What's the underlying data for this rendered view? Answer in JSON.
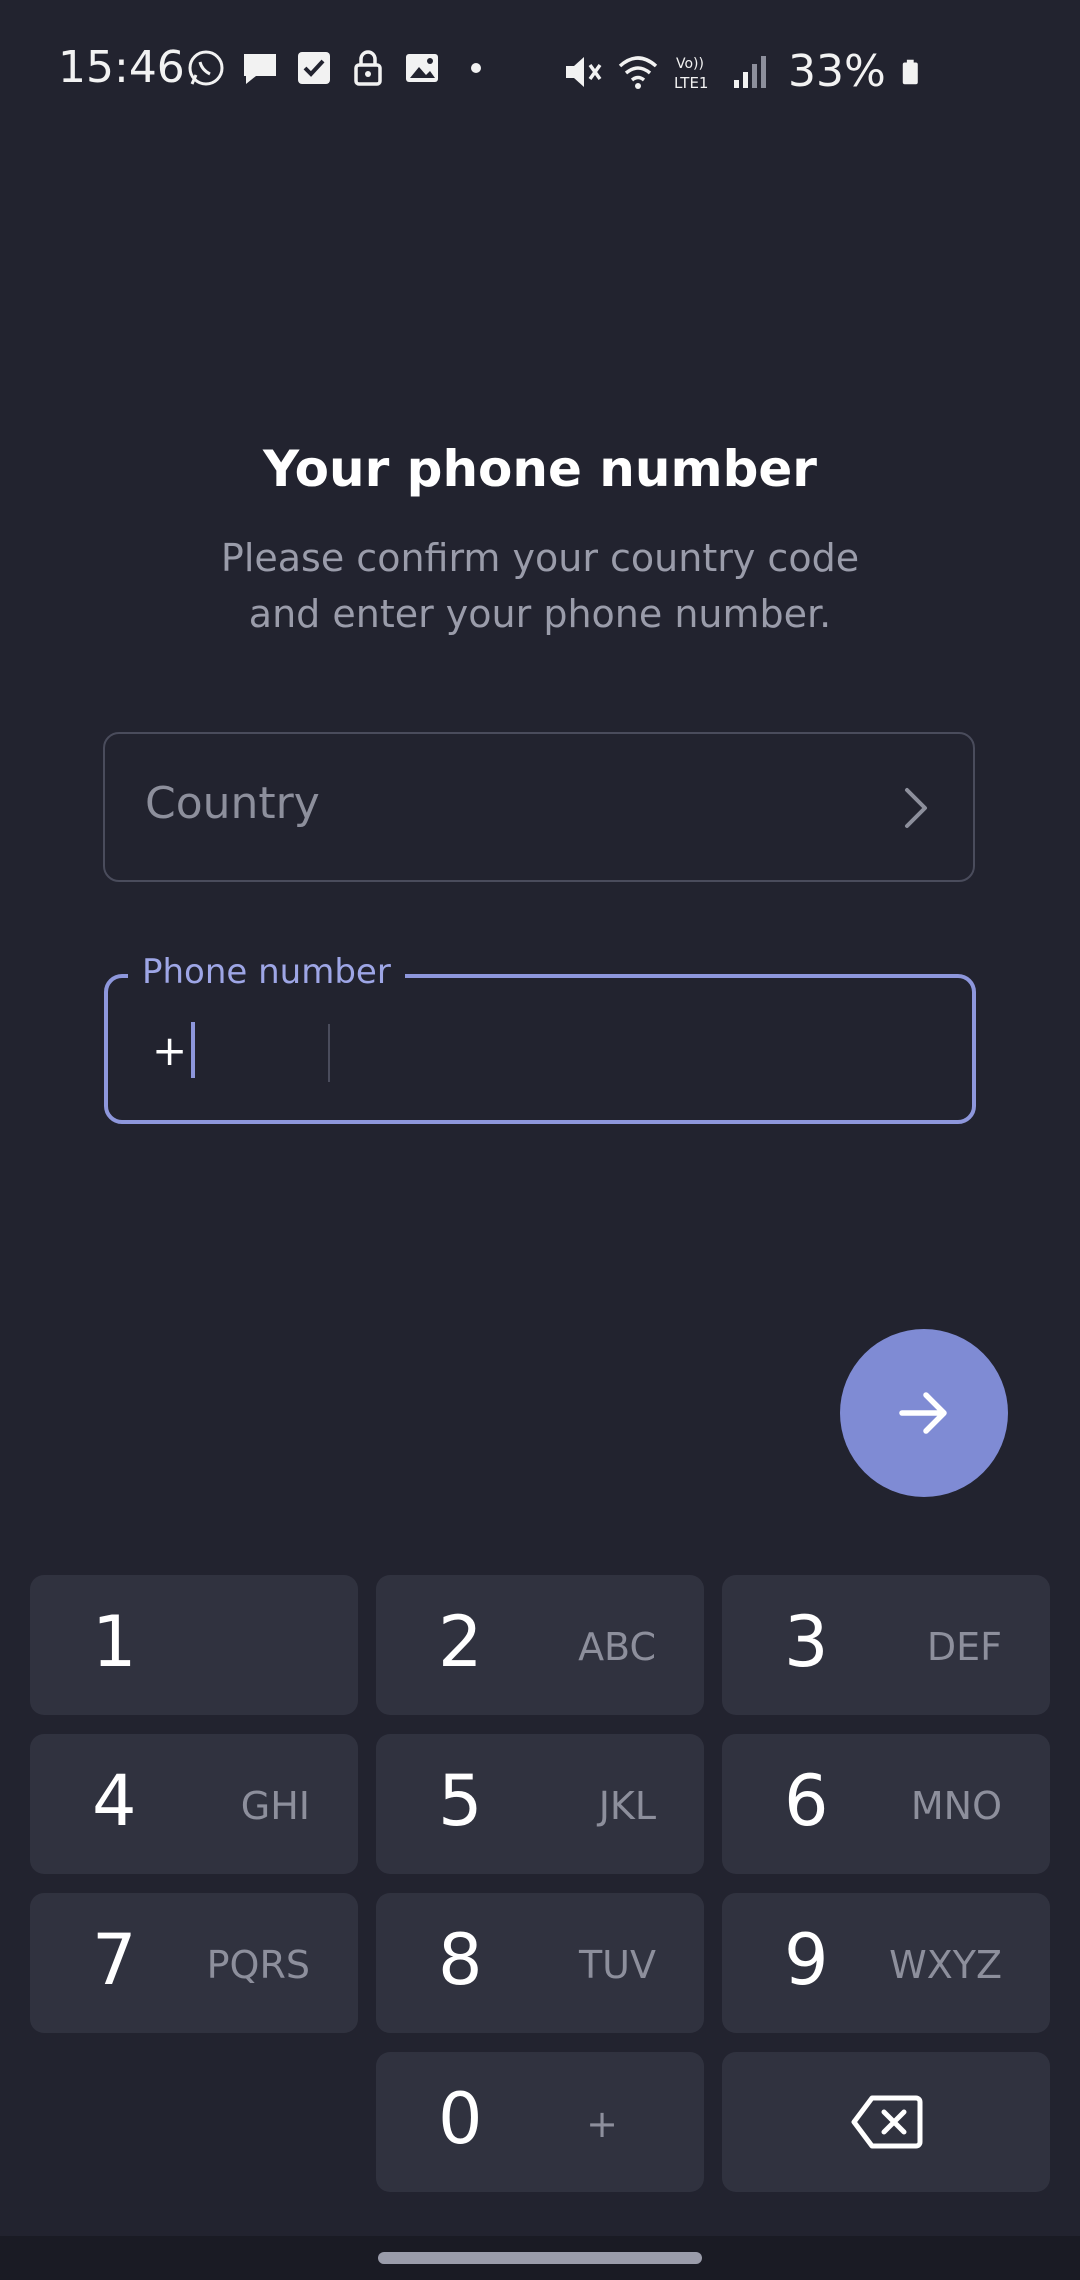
{
  "status_bar": {
    "time": "15:46",
    "left_icons": [
      "whatsapp-icon",
      "message-icon",
      "checkbox-icon",
      "lock-icon",
      "gallery-icon",
      "dot-icon"
    ],
    "right_icons": [
      "mute-icon",
      "wifi-icon",
      "volte-lte-icon",
      "signal-icon"
    ],
    "battery_text": "33%"
  },
  "header": {
    "title": "Your phone number",
    "subtitle_line1": "Please confirm your country code",
    "subtitle_line2": "and enter your phone number."
  },
  "country_field": {
    "placeholder": "Country",
    "icon": "chevron-right-icon"
  },
  "phone_field": {
    "label": "Phone number",
    "prefix": "+",
    "value": ""
  },
  "next_button": {
    "icon": "arrow-right-icon",
    "color": "#7f8bd4"
  },
  "keypad": {
    "keys": [
      {
        "digit": "1",
        "letters": ""
      },
      {
        "digit": "2",
        "letters": "ABC"
      },
      {
        "digit": "3",
        "letters": "DEF"
      },
      {
        "digit": "4",
        "letters": "GHI"
      },
      {
        "digit": "5",
        "letters": "JKL"
      },
      {
        "digit": "6",
        "letters": "MNO"
      },
      {
        "digit": "7",
        "letters": "PQRS"
      },
      {
        "digit": "8",
        "letters": "TUV"
      },
      {
        "digit": "9",
        "letters": "WXYZ"
      },
      {
        "digit": "0",
        "letters": "+"
      }
    ],
    "backspace_icon": "backspace-icon"
  },
  "colors": {
    "background": "#22232f",
    "key_background": "#30323f",
    "accent": "#8e97dc"
  }
}
